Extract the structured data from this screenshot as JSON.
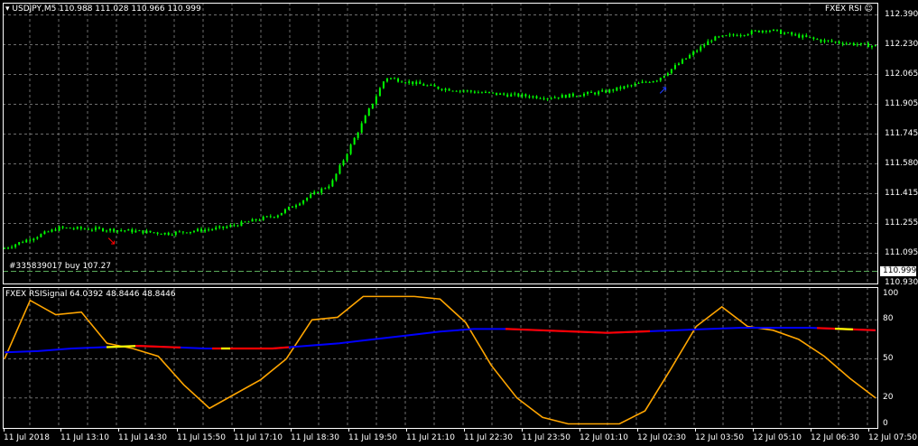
{
  "main_panel": {
    "symbol_line": "USDJPY,M5  110.988 111.028 110.966 110.999",
    "indicator_name": "FXEX RSI",
    "order_label": "#335839017 buy 107.27",
    "current_price": "110.999",
    "y_ticks": [
      "112.390",
      "112.230",
      "112.065",
      "111.905",
      "111.745",
      "111.580",
      "111.415",
      "111.255",
      "111.095",
      "110.930"
    ],
    "colors": {
      "candles": "#00ff00",
      "grid": "#6e6e6e",
      "order_line": "#5aaa5a",
      "sell_arrow": "#ff0000",
      "buy_arrow": "#1e3cff"
    }
  },
  "sub_panel": {
    "title": "FXEX RSISignal 64.0392 48.8446 48.8446",
    "y_ticks": [
      "100",
      "80",
      "50",
      "20",
      "0"
    ],
    "colors": {
      "rsi": "#ffa500",
      "signal": "#0000ff",
      "signal_sell": "#ff0000",
      "signal_mixed": "#ffff00"
    }
  },
  "x_axis": {
    "labels": [
      "11 Jul 2018",
      "11 Jul 13:10",
      "11 Jul 14:30",
      "11 Jul 15:50",
      "11 Jul 17:10",
      "11 Jul 18:30",
      "11 Jul 19:50",
      "11 Jul 21:10",
      "11 Jul 22:30",
      "11 Jul 23:50",
      "12 Jul 01:10",
      "12 Jul 02:30",
      "12 Jul 03:50",
      "12 Jul 05:10",
      "12 Jul 06:30",
      "12 Jul 07:50"
    ]
  },
  "chart_data": [
    {
      "type": "line",
      "title": "USDJPY,M5",
      "ylim": [
        110.93,
        112.39
      ],
      "x": [
        "11 Jul 2018",
        "11 Jul 13:10",
        "11 Jul 14:30",
        "11 Jul 15:50",
        "11 Jul 17:10",
        "11 Jul 18:30",
        "11 Jul 19:50",
        "11 Jul 21:10",
        "11 Jul 22:30",
        "11 Jul 23:50",
        "12 Jul 01:10",
        "12 Jul 02:30",
        "12 Jul 03:50",
        "12 Jul 05:10",
        "12 Jul 06:30",
        "12 Jul 07:50"
      ],
      "close": [
        111.12,
        111.23,
        111.22,
        111.2,
        111.23,
        111.3,
        111.47,
        112.05,
        111.99,
        111.96,
        111.94,
        111.97,
        112.04,
        112.26,
        112.31,
        112.25,
        112.22
      ]
    },
    {
      "type": "line",
      "title": "FXEX RSISignal",
      "ylim": [
        0,
        100
      ],
      "series": [
        {
          "name": "RSI",
          "values": [
            50,
            95,
            84,
            86,
            62,
            58,
            52,
            30,
            12,
            23,
            34,
            50,
            80,
            82,
            98,
            98,
            98,
            96,
            78,
            45,
            20,
            5,
            0,
            0,
            0,
            10,
            42,
            75,
            90,
            75,
            72,
            65,
            52,
            35,
            20
          ]
        },
        {
          "name": "Signal",
          "values": [
            55,
            56,
            58,
            59,
            60,
            59,
            58,
            58,
            58,
            60,
            62,
            65,
            68,
            71,
            73,
            73,
            72,
            71,
            70,
            71,
            72,
            73,
            74,
            74,
            74,
            73,
            72
          ]
        }
      ]
    }
  ]
}
